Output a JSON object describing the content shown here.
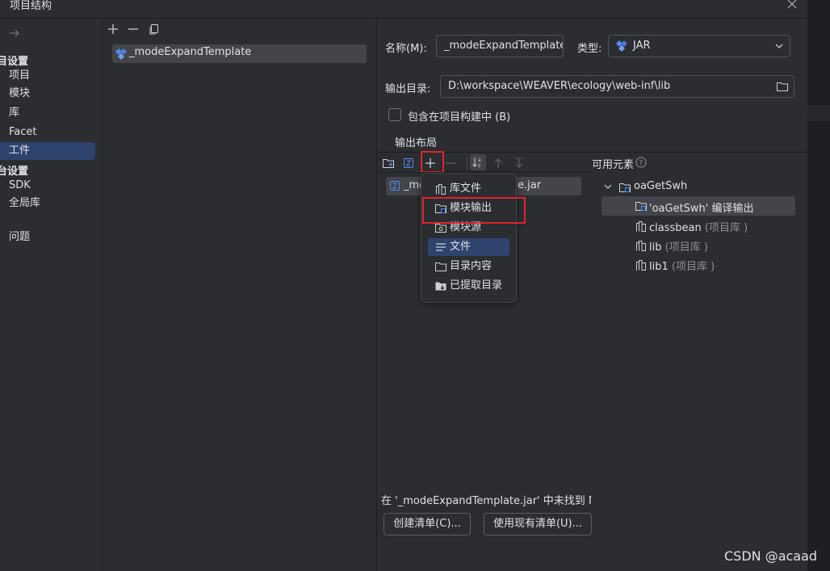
{
  "window": {
    "title": "项目结构"
  },
  "nav": {
    "sections": [
      {
        "label": "目设置",
        "items": [
          "项目",
          "模块",
          "库",
          "Facet",
          "工件"
        ]
      },
      {
        "label": "台设置",
        "items": [
          "SDK",
          "全局库"
        ]
      }
    ],
    "problems": "问题",
    "selected": "工件"
  },
  "artifacts": {
    "items": [
      "_modeExpandTemplate"
    ]
  },
  "form": {
    "name_label": "名称(M):",
    "name_value": "_modeExpandTemplate",
    "type_label": "类型:",
    "type_value": "JAR",
    "output_dir_label": "输出目录:",
    "output_dir_value": "D:\\workspace\\WEAVER\\ecology\\web-inf\\lib",
    "include_in_build_label": "包含在项目构建中 (B)",
    "include_in_build_checked": false,
    "output_layout_label": "输出布局"
  },
  "layout": {
    "root_prefix": "_mo",
    "root_suffix": "e.jar"
  },
  "available": {
    "title": "可用元素",
    "items": [
      {
        "name": "oaGetSwh",
        "suffix": "",
        "level": 0,
        "expanded": true
      },
      {
        "name": "'oaGetSwh' 编译输出",
        "suffix": "",
        "level": 1,
        "selected": true
      },
      {
        "name": "classbean",
        "suffix": " (项目库 )",
        "level": 1
      },
      {
        "name": "lib",
        "suffix": " (项目库 )",
        "level": 1
      },
      {
        "name": "lib1",
        "suffix": " (项目库 )",
        "level": 1
      }
    ]
  },
  "popup_menu": {
    "items": [
      "库文件",
      "模块输出",
      "模块源",
      "文件",
      "目录内容",
      "已提取目录"
    ],
    "selected": "文件",
    "highlighted": "模块输出"
  },
  "bottom": {
    "warning": "在 '_modeExpandTemplate.jar' 中未找到 ME",
    "create_manifest": "创建清单(C)...",
    "use_existing_manifest": "使用现有清单(U)..."
  },
  "watermark": "CSDN @acaad",
  "colors": {
    "highlight_red": "#e0252b",
    "selection": "#2e436e",
    "background": "#2b2d30"
  }
}
